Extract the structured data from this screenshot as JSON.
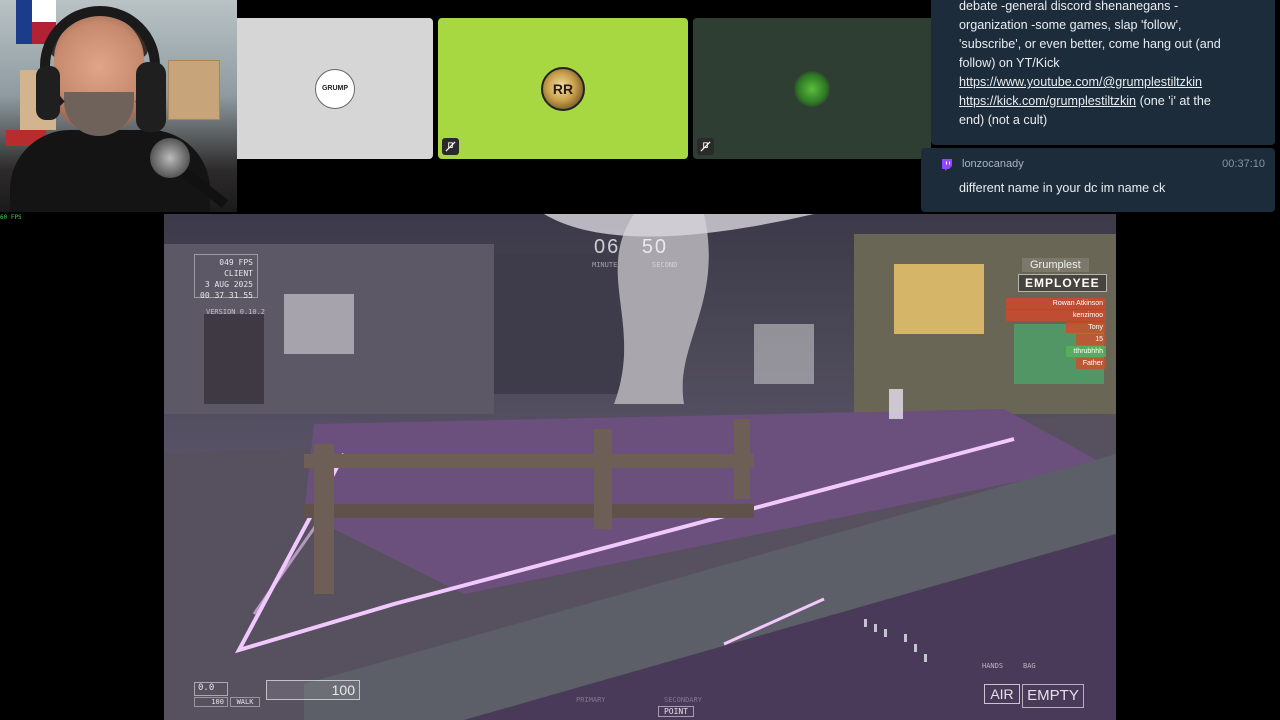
{
  "webcam": {
    "fps_overlay": "60 FPS"
  },
  "discord_tiles": [
    {
      "name": "grumplestiltzkin-tile",
      "avatar_text": "GRUMP",
      "muted": false
    },
    {
      "name": "member-tile-2",
      "avatar_text": "RR",
      "muted": true
    },
    {
      "name": "member-tile-3",
      "avatar_text": "",
      "muted": true
    }
  ],
  "chat": {
    "message_1": {
      "line_1": "debate -general discord shenanegans -",
      "line_2": "organization -some games, slap 'follow',",
      "line_3": "'subscribe', or even better, come hang out (and",
      "line_4": "follow) on YT/Kick",
      "link_youtube": "https://www.youtube.com/@grumplestiltzkin",
      "link_kick": "https://kick.com/grumplestiltzkin",
      "link_kick_suffix": " (one 'i' at the",
      "line_7": "end) (not a cult)"
    },
    "message_2": {
      "platform_icon": "twitch-icon",
      "username": "lonzocanady",
      "timestamp": "00:37:10",
      "text": "different name in your dc im name ck"
    }
  },
  "game_hud": {
    "timer": {
      "minutes": "06",
      "seconds": "50",
      "minutes_label": "MINUTE",
      "seconds_label": "SECOND"
    },
    "stats": {
      "fps": "049 FPS",
      "mode": "CLIENT",
      "date": "3 AUG 2025",
      "time": "00 37 31 55"
    },
    "version": "VERSION 0.10.2",
    "speed": {
      "value": "0.0",
      "max": "100",
      "walk_label": "WALK"
    },
    "health": "100",
    "weapons": {
      "primary_label": "PRIMARY",
      "secondary_label": "SECONDARY",
      "point_label": "POINT"
    },
    "inventory": {
      "hands_label": "HANDS",
      "bag_label": "BAG",
      "hands_value": "AIR",
      "bag_value": "EMPTY"
    },
    "team": {
      "title": "Grumplest",
      "role": "EMPLOYEE",
      "players": [
        "Rowan Atkinson",
        "kenzimoo",
        "Tony",
        "15",
        "tthrubhhh",
        "Father"
      ]
    }
  },
  "colors": {
    "chat_background": "#1d2c3a",
    "tile_green": "#a7d842",
    "tile_gray": "#d6d6d6",
    "tile_dark_green": "#2f3e33",
    "neon_pink": "#f2c9ff",
    "twitch_purple": "#9146ff"
  }
}
